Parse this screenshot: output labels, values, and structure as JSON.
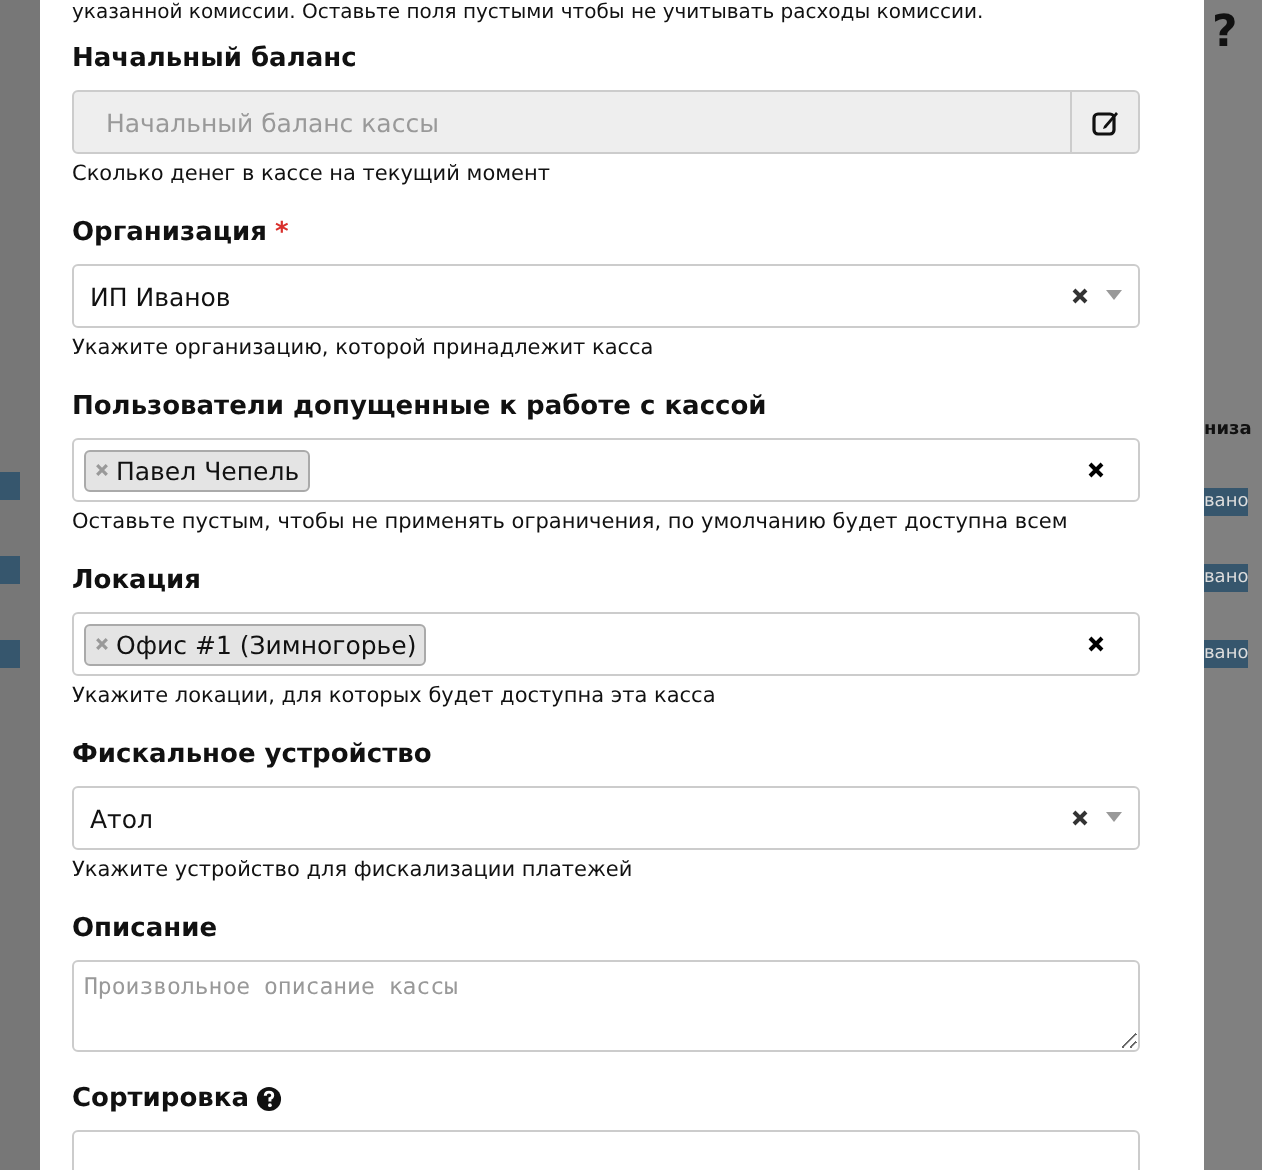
{
  "background": {
    "help_icon": "?",
    "column_header": "низа",
    "cells": [
      "вано",
      "вано",
      "вано"
    ]
  },
  "modal": {
    "intro": "указанной комиссии. Оставьте поля пустыми чтобы не учитывать расходы комиссии.",
    "fields": [
      {
        "kind": "addon",
        "label": "Начальный баланс",
        "placeholder": "Начальный баланс кассы",
        "disabled": true,
        "help": "Сколько денег в кассе на текущий момент"
      },
      {
        "kind": "select",
        "label": "Организация",
        "required_mark": "*",
        "value": "ИП Иванов",
        "help": "Укажите организацию, которой принадлежит касса"
      },
      {
        "kind": "tags",
        "label": "Пользователи допущенные к работе с кассой",
        "tags": [
          "Павел Чепель"
        ],
        "help": "Оставьте пустым, чтобы не применять ограничения, по умолчанию будет доступна всем"
      },
      {
        "kind": "tags",
        "label": "Локация",
        "tags": [
          "Офис #1 (Зимногорье)"
        ],
        "help": "Укажите локации, для которых будет доступна эта касса"
      },
      {
        "kind": "select",
        "label": "Фискальное устройство",
        "value": "Атол",
        "help": "Укажите устройство для фискализации платежей"
      },
      {
        "kind": "textarea",
        "label": "Описание",
        "placeholder": "Произвольное описание кассы"
      },
      {
        "kind": "input",
        "label": "Сортировка",
        "info": true
      }
    ]
  }
}
